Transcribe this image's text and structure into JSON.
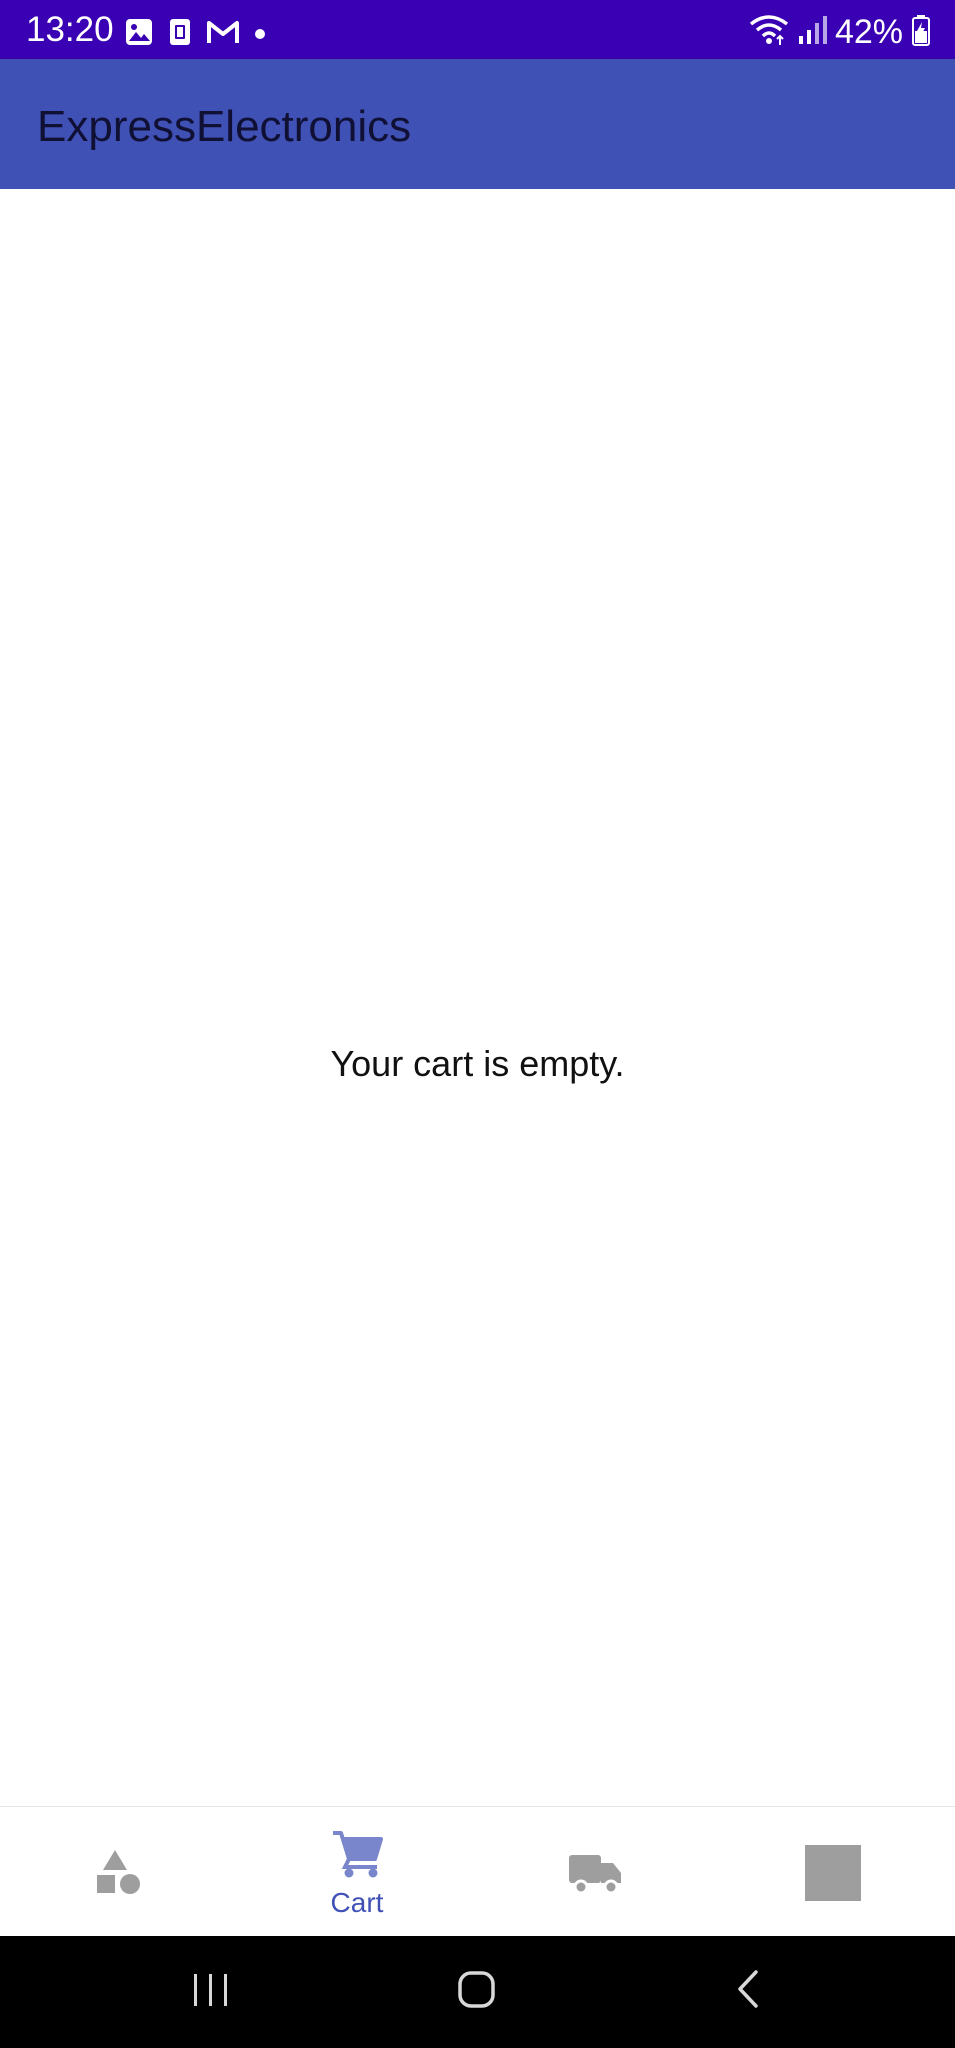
{
  "status_bar": {
    "time": "13:20",
    "battery": "42%",
    "icons_left": [
      "gallery-icon",
      "sim-icon",
      "gmail-icon",
      "dot-icon"
    ],
    "icons_right": [
      "wifi-icon",
      "signal-icon",
      "battery-icon"
    ],
    "background": "#3a00b3"
  },
  "app_bar": {
    "title": "ExpressElectronics",
    "background": "#3f51b5"
  },
  "content": {
    "empty_message": "Your cart is empty."
  },
  "bottom_nav": {
    "items": [
      {
        "icon": "shapes-icon",
        "label": ""
      },
      {
        "icon": "cart-icon",
        "label": "Cart",
        "selected": true
      },
      {
        "icon": "truck-icon",
        "label": ""
      },
      {
        "icon": "square-icon",
        "label": ""
      }
    ],
    "accent": "#3f51b5",
    "inactive": "#9e9e9e"
  },
  "system_nav": {
    "buttons": [
      "recents-button",
      "home-button",
      "back-button"
    ]
  }
}
